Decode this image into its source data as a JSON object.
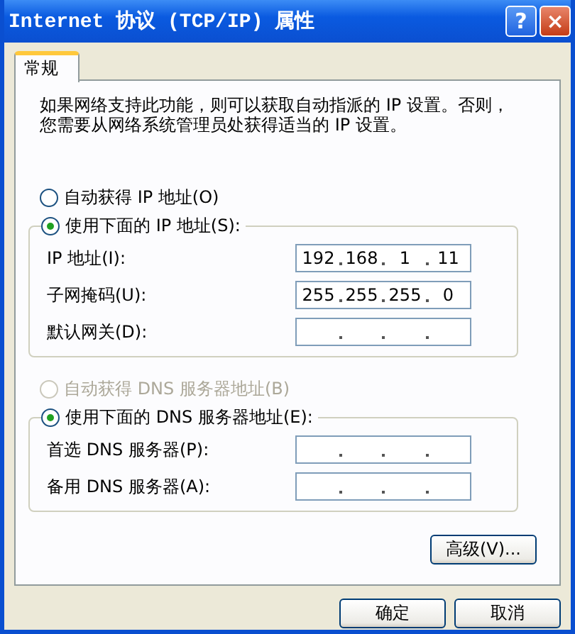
{
  "window": {
    "title": "Internet 协议 (TCP/IP) 属性",
    "help_button": "?",
    "close_button": "×"
  },
  "tabs": [
    {
      "label": "常规",
      "selected": true
    }
  ],
  "description": "如果网络支持此功能，则可以获取自动指派的 IP 设置。否则，您需要从网络系统管理员处获得适当的 IP 设置。",
  "ip": {
    "auto": {
      "label": "自动获得 IP 地址(O)",
      "selected": false,
      "disabled": false
    },
    "manual": {
      "label": "使用下面的 IP 地址(S):",
      "selected": true,
      "disabled": false
    },
    "fields": [
      {
        "label": "IP 地址(I):",
        "segments": [
          "192",
          "168",
          "1",
          "11"
        ]
      },
      {
        "label": "子网掩码(U):",
        "segments": [
          "255",
          "255",
          "255",
          "0"
        ]
      },
      {
        "label": "默认网关(D):"
      }
    ]
  },
  "dns": {
    "auto": {
      "label": "自动获得 DNS 服务器地址(B)",
      "selected": false,
      "disabled": true
    },
    "manual": {
      "label": "使用下面的 DNS 服务器地址(E):",
      "selected": true,
      "disabled": false
    },
    "fields": [
      {
        "label": "首选 DNS 服务器(P):"
      },
      {
        "label": "备用 DNS 服务器(A):"
      }
    ]
  },
  "advanced_button": "高级(V)...",
  "buttons": [
    "确定",
    "取消"
  ]
}
